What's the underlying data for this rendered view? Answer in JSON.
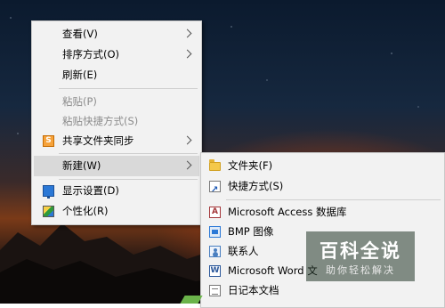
{
  "desktop": {
    "wallpaper": "night-sky-mountains-sunset"
  },
  "context_menu": {
    "items": [
      {
        "label": "查看(V)",
        "has_submenu": true
      },
      {
        "label": "排序方式(O)",
        "has_submenu": true
      },
      {
        "label": "刷新(E)"
      },
      {
        "label": "粘贴(P)",
        "disabled": true
      },
      {
        "label": "粘贴快捷方式(S)",
        "disabled": true
      },
      {
        "label": "共享文件夹同步",
        "icon": "sync-folder-icon",
        "has_submenu": true
      },
      {
        "label": "新建(W)",
        "has_submenu": true,
        "highlighted": true
      },
      {
        "label": "显示设置(D)",
        "icon": "display-settings-icon"
      },
      {
        "label": "个性化(R)",
        "icon": "personalize-icon"
      }
    ]
  },
  "new_submenu": {
    "items": [
      {
        "label": "文件夹(F)",
        "icon": "folder-icon"
      },
      {
        "label": "快捷方式(S)",
        "icon": "shortcut-icon"
      },
      {
        "label": "Microsoft Access 数据库",
        "icon": "access-icon"
      },
      {
        "label": "BMP 图像",
        "icon": "bmp-image-icon"
      },
      {
        "label": "联系人",
        "icon": "contact-icon"
      },
      {
        "label": "Microsoft Word 文",
        "icon": "word-icon"
      },
      {
        "label": "日记本文档",
        "icon": "journal-icon"
      }
    ]
  },
  "icons": {
    "sync_glyph": "S",
    "access_glyph": "A",
    "word_glyph": "W"
  },
  "watermark": {
    "title": "百科全说",
    "subtitle": "助你轻松解决"
  },
  "colors": {
    "menu_bg": "#f2f2f2",
    "highlight": "#d9d9d9",
    "disabled_text": "#8c8c8c"
  }
}
